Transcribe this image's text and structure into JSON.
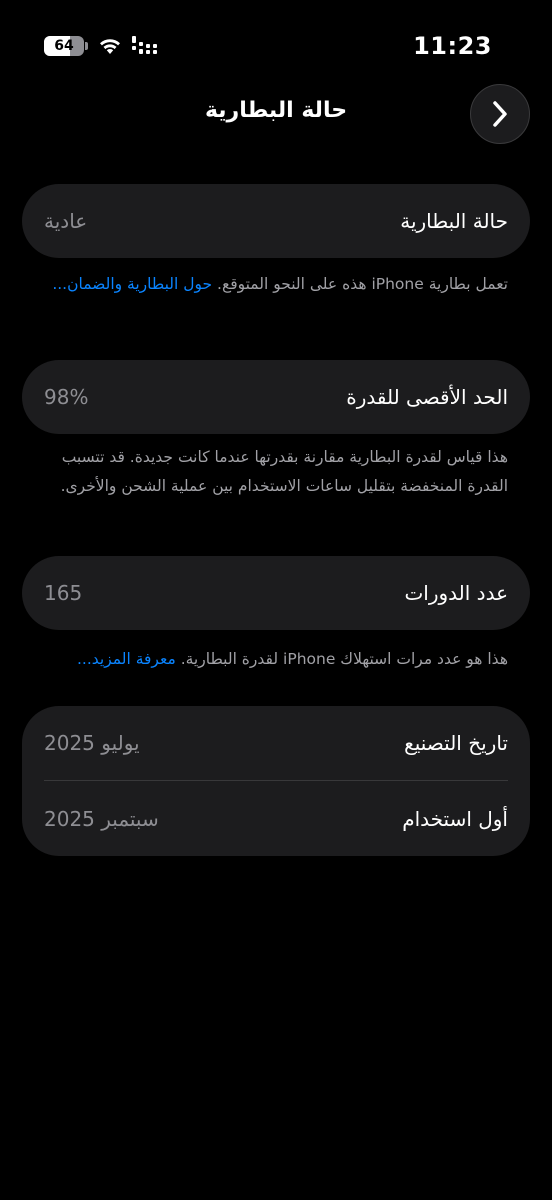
{
  "status_bar": {
    "battery_level": "64",
    "battery_fraction": 0.64,
    "time": "11:23"
  },
  "nav": {
    "title": "حالة البطارية",
    "back_icon": "chevron-right-icon"
  },
  "health": {
    "label": "حالة البطارية",
    "value": "عادية",
    "note_text": "تعمل بطارية iPhone هذه على النحو المتوقع. ",
    "note_link": "حول البطارية والضمان..."
  },
  "capacity": {
    "label": "الحد الأقصى للقدرة",
    "value": "98%",
    "note_text": "هذا قياس لقدرة البطارية مقارنة بقدرتها عندما كانت جديدة. قد تتسبب القدرة المنخفضة بتقليل ساعات الاستخدام بين عملية الشحن والأخرى."
  },
  "cycles": {
    "label": "عدد الدورات",
    "value": "165",
    "note_text": "هذا هو عدد مرات استهلاك iPhone لقدرة البطارية. ",
    "note_link": "معرفة المزيد..."
  },
  "dates": {
    "manufacture_label": "تاريخ التصنيع",
    "manufacture_value": "يوليو 2025",
    "first_use_label": "أول استخدام",
    "first_use_value": "سبتمبر 2025"
  },
  "colors": {
    "background": "#000000",
    "card": "#1c1c1e",
    "link": "#0a84ff",
    "secondary_text": "#8e8e93"
  }
}
